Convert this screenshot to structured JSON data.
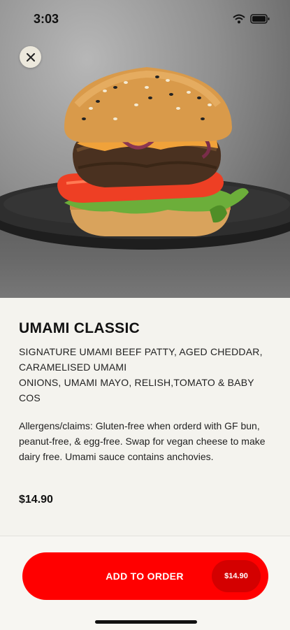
{
  "status_bar": {
    "time": "3:03"
  },
  "hero": {
    "close_icon": "close-icon",
    "image": "burger-photo"
  },
  "item": {
    "name": "UMAMI CLASSIC",
    "description_line1": "SIGNATURE UMAMI BEEF PATTY, AGED CHEDDAR, CARAMELISED UMAMI",
    "description_line2": "ONIONS, UMAMI MAYO, RELISH,TOMATO & BABY COS",
    "allergens": "Allergens/claims: Gluten-free when orderd with GF bun, peanut-free, & egg-free. Swap for vegan cheese to make dairy free. Umami sauce contains anchovies.",
    "price": "$14.90"
  },
  "order_button": {
    "label": "ADD TO ORDER",
    "price": "$14.90"
  },
  "colors": {
    "accent": "#ff0000",
    "accent_dark": "#d40000",
    "background": "#f4f3ee"
  }
}
